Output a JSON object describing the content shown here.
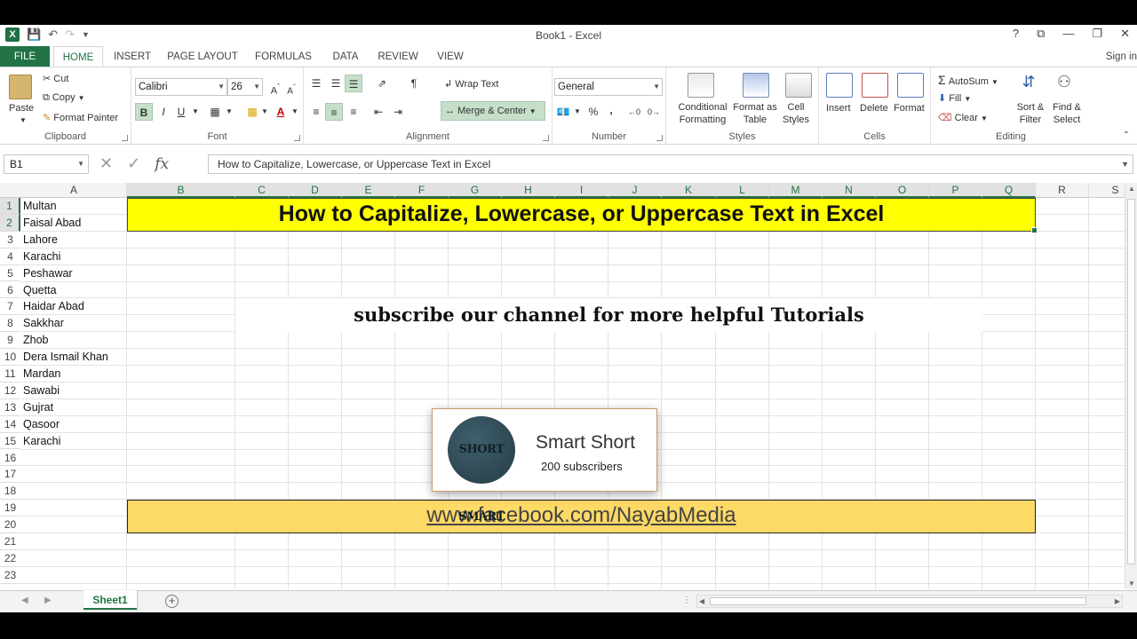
{
  "window": {
    "title": "Book1 - Excel",
    "sign_in": "Sign in",
    "controls": [
      "?",
      "⧉",
      "—",
      "❐",
      "✕"
    ]
  },
  "tabs": [
    "FILE",
    "HOME",
    "INSERT",
    "PAGE LAYOUT",
    "FORMULAS",
    "DATA",
    "REVIEW",
    "VIEW"
  ],
  "ribbon": {
    "clipboard": {
      "label": "Clipboard",
      "paste": "Paste",
      "cut": "Cut",
      "copy": "Copy",
      "format_painter": "Format Painter"
    },
    "font": {
      "label": "Font",
      "name": "Calibri",
      "size": "26",
      "bold": "B",
      "italic": "I",
      "underline": "U"
    },
    "alignment": {
      "label": "Alignment",
      "wrap_text": "Wrap Text",
      "merge_center": "Merge & Center"
    },
    "number": {
      "label": "Number",
      "format": "General",
      "percent": "%",
      "comma": ","
    },
    "styles": {
      "label": "Styles",
      "conditional_formatting": "Conditional Formatting",
      "format_as_table": "Format as Table",
      "cell_styles": "Cell Styles"
    },
    "cells": {
      "label": "Cells",
      "insert": "Insert",
      "delete": "Delete",
      "format": "Format"
    },
    "editing": {
      "label": "Editing",
      "autosum": "AutoSum",
      "fill": "Fill",
      "clear": "Clear",
      "sort_filter": "Sort & Filter",
      "find_select": "Find & Select"
    }
  },
  "formula_bar": {
    "name_box": "B1",
    "fx": "fx",
    "content": "How to Capitalize, Lowercase, or Uppercase Text in Excel"
  },
  "columns": [
    "A",
    "B",
    "C",
    "D",
    "E",
    "F",
    "G",
    "H",
    "I",
    "J",
    "K",
    "L",
    "M",
    "N",
    "O",
    "P",
    "Q",
    "R",
    "S"
  ],
  "rows": [
    "1",
    "2",
    "3",
    "4",
    "5",
    "6",
    "7",
    "8",
    "9",
    "10",
    "11",
    "12",
    "13",
    "14",
    "15",
    "16",
    "17",
    "18",
    "19",
    "20",
    "21",
    "22",
    "23"
  ],
  "column_a": [
    "Multan",
    "Faisal Abad",
    "Lahore",
    "Karachi",
    "Peshawar",
    "Quetta",
    "Haidar Abad",
    "Sakkhar",
    "Zhob",
    "Dera Ismail Khan",
    "Mardan",
    "Sawabi",
    "Gujrat",
    "Qasoor",
    "Karachi"
  ],
  "banner": {
    "title": "How to Capitalize, Lowercase, or Uppercase Text in Excel",
    "title_bg": "#ffff00",
    "subscribe": "subscribe our channel for more helpful Tutorials",
    "link": "www.facebook.com/NayabMedia",
    "link_bg": "#fdd966"
  },
  "channel_card": {
    "avatar_text": "SHORT SMART",
    "name": "Smart Short",
    "subscribers": "200 subscribers"
  },
  "sheets": {
    "active": "Sheet1"
  },
  "accent": "#217346"
}
